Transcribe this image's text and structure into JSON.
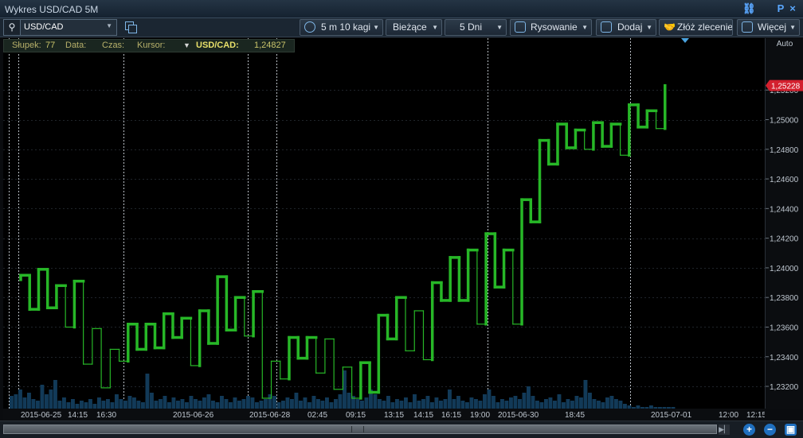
{
  "window": {
    "title": "Wykres USD/CAD 5M",
    "link_icon": "link-icon",
    "pin_label": "P",
    "close_label": "×"
  },
  "toolbar": {
    "symbol": "USD/CAD",
    "interval": "5 m 10 kagi",
    "mode": "Bieżące",
    "range": "5 Dni",
    "drawing": "Rysowanie",
    "add": "Dodaj",
    "order": "Złóż zlecenie",
    "more": "Więcej"
  },
  "infobar": {
    "bar_label": "Słupek:",
    "bar_value": "77",
    "date_label": "Data:",
    "time_label": "Czas:",
    "cursor_label": "Kursor:",
    "symbol": "USD/CAD:",
    "price": "1,24827"
  },
  "yaxis": {
    "auto_label": "Auto",
    "current_price": "1,25228"
  },
  "colors": {
    "kagi": "#27b727",
    "volume": "#123a58",
    "price_tag": "#d3202e",
    "background": "#000000"
  },
  "chart_data": {
    "type": "kagi",
    "symbol": "USD/CAD",
    "timeframe": "5M",
    "reversal_pips": 10,
    "ylim": [
      1.2305,
      1.2555
    ],
    "yticks": [
      "1,23200",
      "1,23400",
      "1,23600",
      "1,23800",
      "1,24000",
      "1,24200",
      "1,24400",
      "1,24600",
      "1,24800",
      "1,25000",
      "1,25200"
    ],
    "ytick_values": [
      1.232,
      1.234,
      1.236,
      1.238,
      1.24,
      1.242,
      1.244,
      1.246,
      1.248,
      1.25,
      1.252
    ],
    "xticks": [
      "2015-06-25",
      "14:15",
      "16:30",
      "2015-06-26",
      "2015-06-28",
      "02:45",
      "09:15",
      "13:15",
      "14:15",
      "16:15",
      "19:00",
      "2015-06-30",
      "18:45",
      "2015-07-01",
      "12:00",
      "12:15"
    ],
    "kagi_prices": [
      1.2392,
      1.2395,
      1.2372,
      1.2399,
      1.2373,
      1.2388,
      1.236,
      1.2391,
      1.2335,
      1.2359,
      1.2319,
      1.2345,
      1.2337,
      1.2362,
      1.2345,
      1.2362,
      1.2346,
      1.2369,
      1.2353,
      1.2366,
      1.2334,
      1.2371,
      1.2349,
      1.2394,
      1.2358,
      1.238,
      1.2354,
      1.2384,
      1.2312,
      1.2337,
      1.2325,
      1.2353,
      1.2339,
      1.2353,
      1.2329,
      1.2352,
      1.2318,
      1.2333,
      1.2312,
      1.2336,
      1.2316,
      1.2368,
      1.2352,
      1.238,
      1.2344,
      1.2371,
      1.2338,
      1.239,
      1.2378,
      1.2407,
      1.2378,
      1.2412,
      1.2362,
      1.2423,
      1.2387,
      1.2412,
      1.2362,
      1.2446,
      1.2431,
      1.2486,
      1.247,
      1.2497,
      1.2481,
      1.2493,
      1.248,
      1.2498,
      1.2482,
      1.2497,
      1.2476,
      1.251,
      1.2495,
      1.2506,
      1.2494,
      1.2523
    ],
    "volumes": [
      8,
      9,
      12,
      7,
      10,
      6,
      5,
      15,
      9,
      12,
      18,
      5,
      7,
      4,
      6,
      3,
      5,
      4,
      6,
      3,
      7,
      5,
      6,
      4,
      9,
      6,
      5,
      8,
      7,
      5,
      4,
      22,
      10,
      5,
      6,
      8,
      4,
      7,
      5,
      6,
      4,
      8,
      6,
      5,
      7,
      9,
      5,
      4,
      8,
      6,
      4,
      7,
      5,
      6,
      8,
      7,
      4,
      5,
      6,
      9,
      8,
      4,
      5,
      7,
      6,
      10,
      5,
      7,
      4,
      8,
      6,
      5,
      7,
      4,
      6,
      9,
      24,
      10,
      8,
      6,
      5,
      7,
      12,
      9,
      6,
      5,
      8,
      4,
      6,
      5,
      7,
      4,
      9,
      5,
      6,
      8,
      4,
      7,
      5,
      6,
      12,
      6,
      8,
      5,
      4,
      7,
      6,
      5,
      9,
      12,
      8,
      4,
      6,
      5,
      7,
      8,
      6,
      10,
      14,
      8,
      5,
      4,
      6,
      7,
      5,
      9,
      4,
      6,
      5,
      8,
      7,
      18,
      10,
      6,
      5,
      4,
      7,
      8,
      6,
      5,
      3,
      2,
      1,
      2,
      1,
      1,
      2,
      1,
      1,
      1,
      1,
      1
    ]
  }
}
